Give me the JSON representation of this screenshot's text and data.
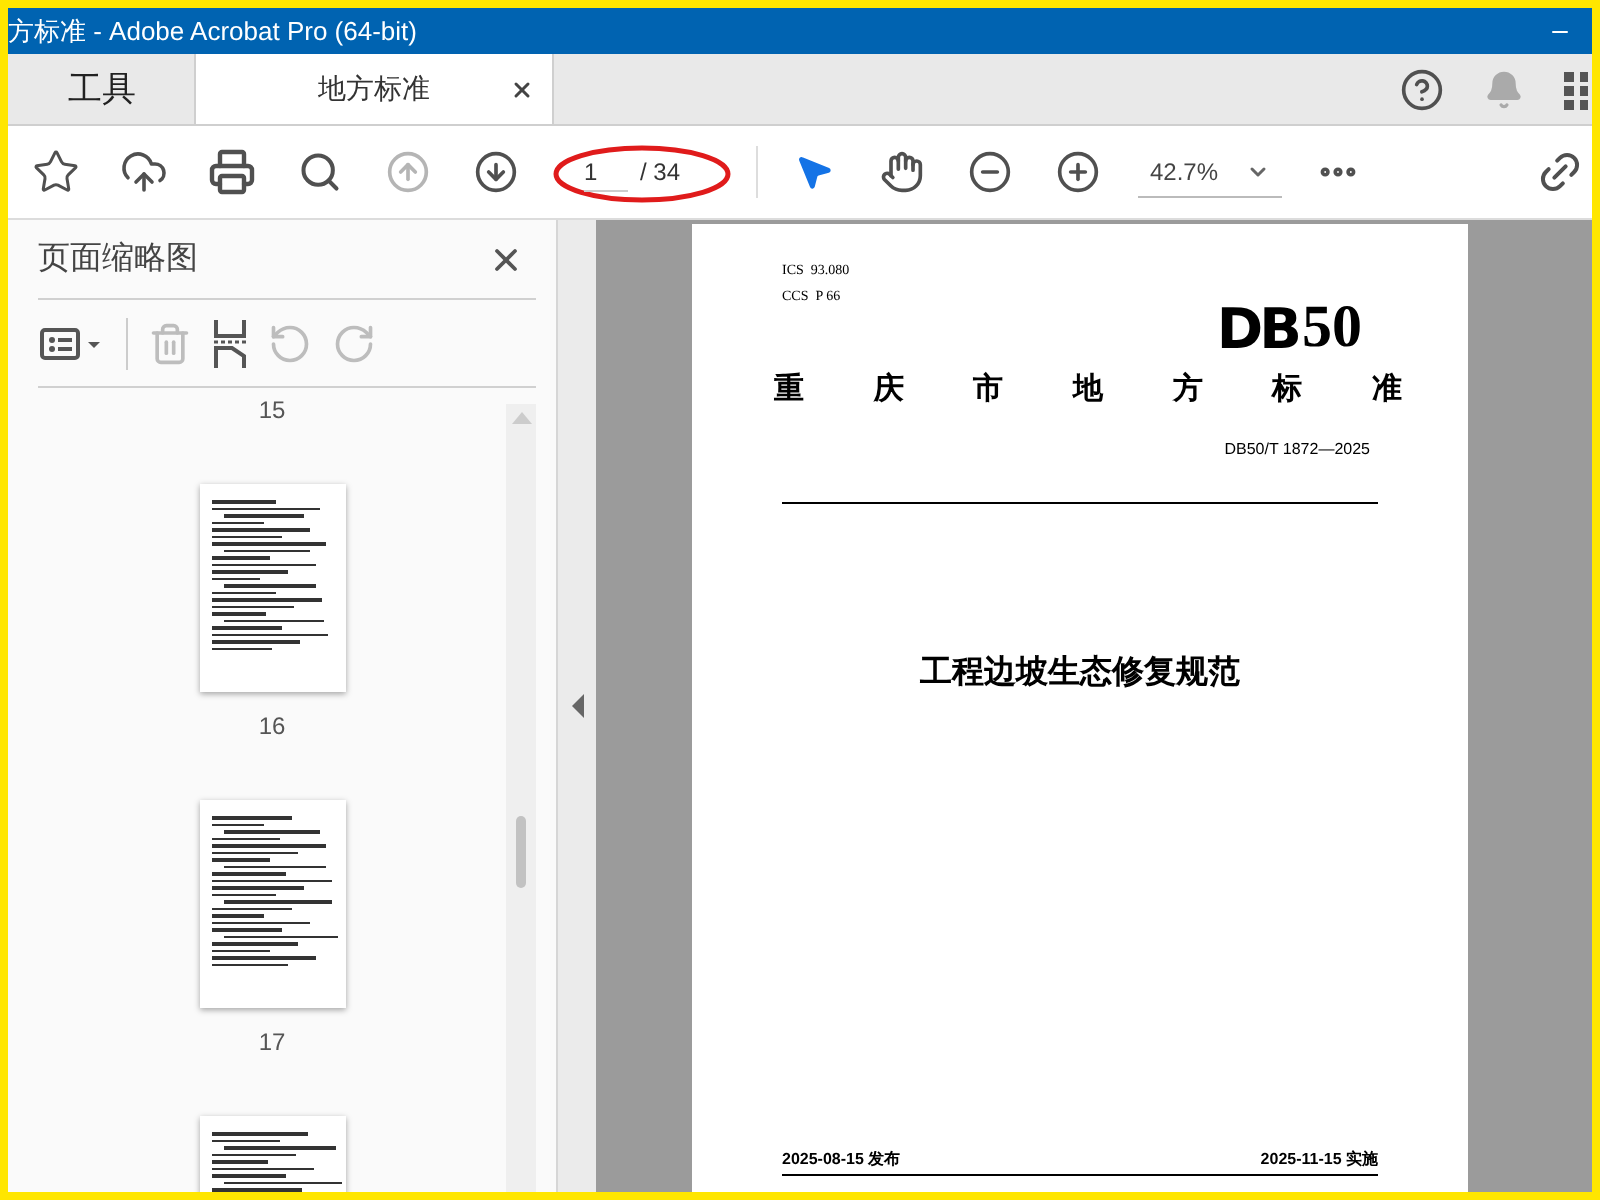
{
  "window": {
    "title": "方标准 - Adobe Acrobat Pro (64-bit)"
  },
  "tabs": [
    {
      "label": "工具",
      "selected": false,
      "closable": false
    },
    {
      "label": "地方标准",
      "selected": true,
      "closable": true
    }
  ],
  "toolbar": {
    "page_number": "1",
    "page_count": "/ 34",
    "zoom": "42.7%"
  },
  "thumbnails_panel": {
    "title": "页面缩略图",
    "pages": [
      {
        "kind": "label-only",
        "label": "15"
      },
      {
        "kind": "thumb",
        "label": "16"
      },
      {
        "kind": "thumb",
        "label": "17"
      },
      {
        "kind": "thumb"
      }
    ]
  },
  "document": {
    "ics": "ICS  93.080",
    "ccs": "CCS  P 66",
    "logo_letters": "DB",
    "logo_number": "50",
    "heading": "重庆市地方标准",
    "code": "DB50/T 1872—2025",
    "title": "工程边坡生态修复规范",
    "publish_date": "2025-08-15 发布",
    "effective_date": "2025-11-15 实施"
  }
}
